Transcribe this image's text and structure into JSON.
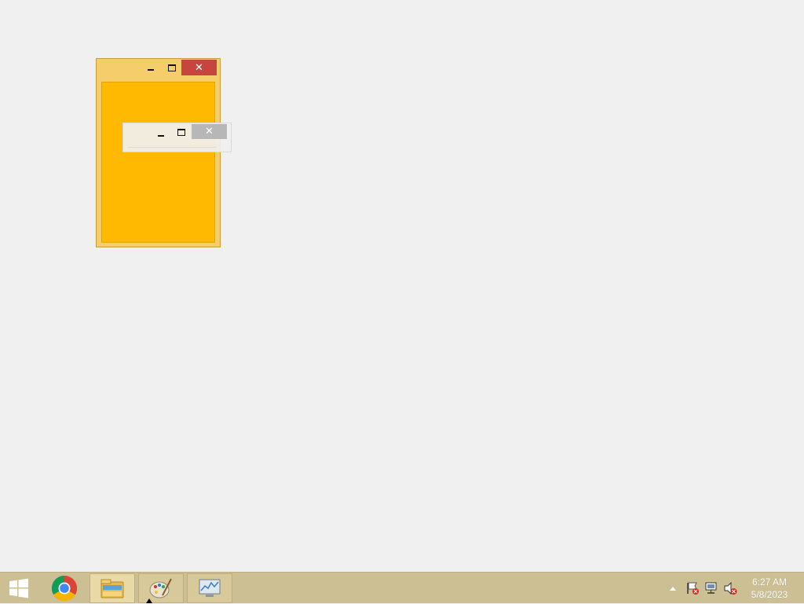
{
  "windows": {
    "outer": {
      "minimize": "minimize",
      "maximize": "maximize",
      "close": "close",
      "close_glyph": "✕",
      "client_color": "#ffba00",
      "frame_color": "#f5cd6a",
      "close_color": "#c7453f"
    },
    "inner": {
      "minimize": "minimize",
      "maximize": "maximize",
      "close": "close",
      "close_glyph": "✕"
    }
  },
  "taskbar": {
    "start_icon": "windows-logo-icon",
    "pinned": [
      "chrome-icon",
      "file-explorer-icon",
      "paint-icon",
      "performance-monitor-icon"
    ],
    "tray": {
      "icons": [
        "show-hidden-icons-arrow",
        "action-center-flag-icon",
        "network-icon",
        "volume-muted-icon"
      ],
      "time": "6:27 AM",
      "date": "5/8/2023"
    },
    "color": "#cdbf94"
  }
}
